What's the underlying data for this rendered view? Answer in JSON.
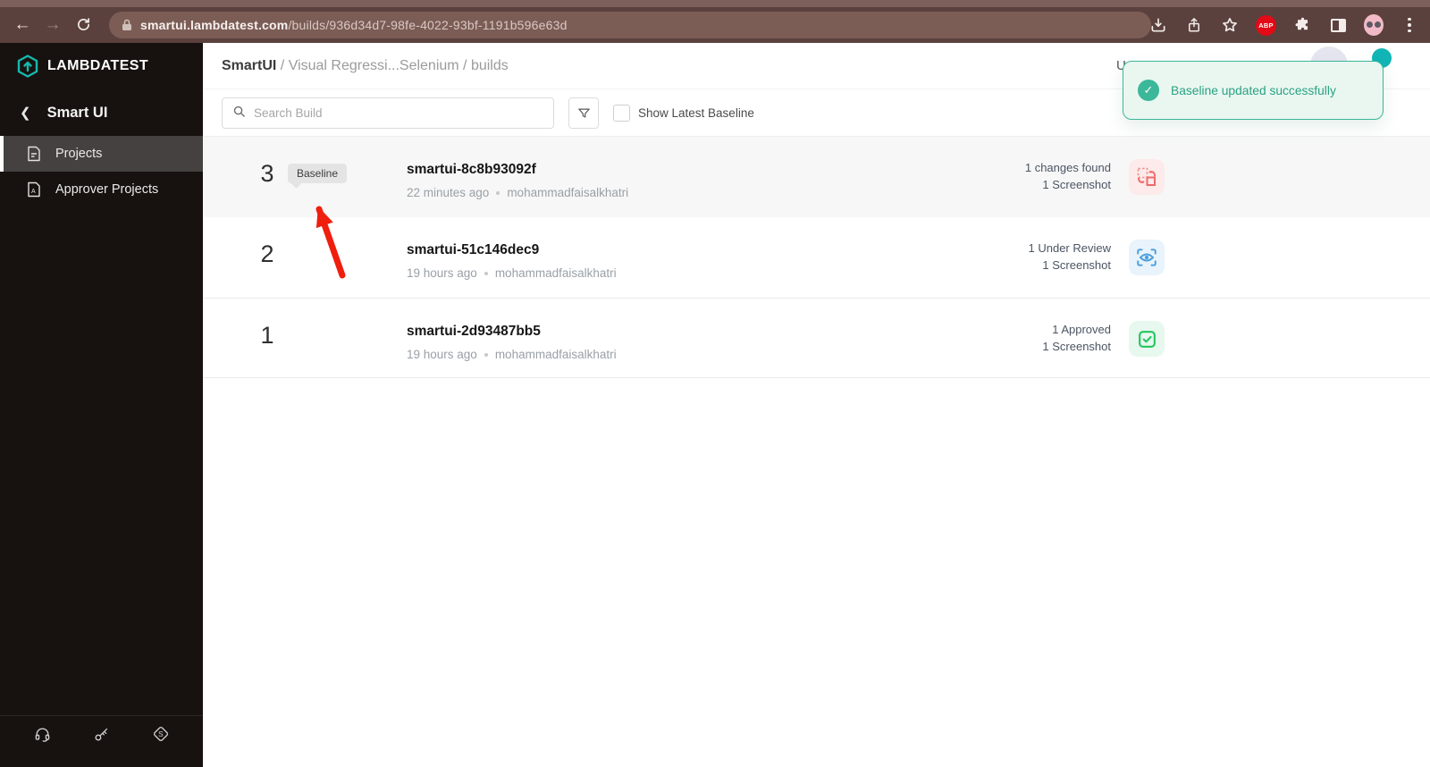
{
  "browser": {
    "url_domain": "smartui.lambdatest.com",
    "url_path": "/builds/936d34d7-98fe-4022-93bf-1191b596e63d",
    "abp_label": "ABP"
  },
  "sidebar": {
    "logo_text": "LAMBDATEST",
    "section_title": "Smart UI",
    "items": [
      {
        "label": "Projects",
        "selected": true
      },
      {
        "label": "Approver Projects",
        "selected": false
      }
    ],
    "footer_icons": [
      "support-headset-icon",
      "access-key-icon",
      "switch-s-icon"
    ]
  },
  "header": {
    "breadcrumb_root": "SmartUI",
    "breadcrumb_rest": " / Visual Regressi...Selenium / builds",
    "partial_text": "U"
  },
  "toolbar": {
    "search_placeholder": "Search Build",
    "checkbox_label": "Show Latest Baseline",
    "checkbox_checked": false
  },
  "toast": {
    "message": "Baseline updated successfully"
  },
  "builds": [
    {
      "number": "3",
      "badge": "Baseline",
      "name": "smartui-8c8b93092f",
      "time": "22 minutes ago",
      "author": "mohammadfaisalkhatri",
      "status_line1": "1 changes found",
      "status_line2": "1 Screenshot",
      "status_type": "changes-found"
    },
    {
      "number": "2",
      "name": "smartui-51c146dec9",
      "time": "19 hours ago",
      "author": "mohammadfaisalkhatri",
      "status_line1": "1 Under Review",
      "status_line2": "1 Screenshot",
      "status_type": "under-review"
    },
    {
      "number": "1",
      "name": "smartui-2d93487bb5",
      "time": "19 hours ago",
      "author": "mohammadfaisalkhatri",
      "status_line1": "1 Approved",
      "status_line2": "1 Screenshot",
      "status_type": "approved"
    }
  ],
  "colors": {
    "brand_teal": "#16b8ac",
    "toast_green": "#3bb79a",
    "changes_pink": "#ef6a6a",
    "review_blue": "#4a9fe0",
    "approved_green": "#22c55e",
    "arrow_red": "#f01e0e",
    "chrome_brown": "#5b413d",
    "sidebar_dark": "#17120f"
  },
  "annotation": {
    "arrow_target": "Baseline badge"
  }
}
